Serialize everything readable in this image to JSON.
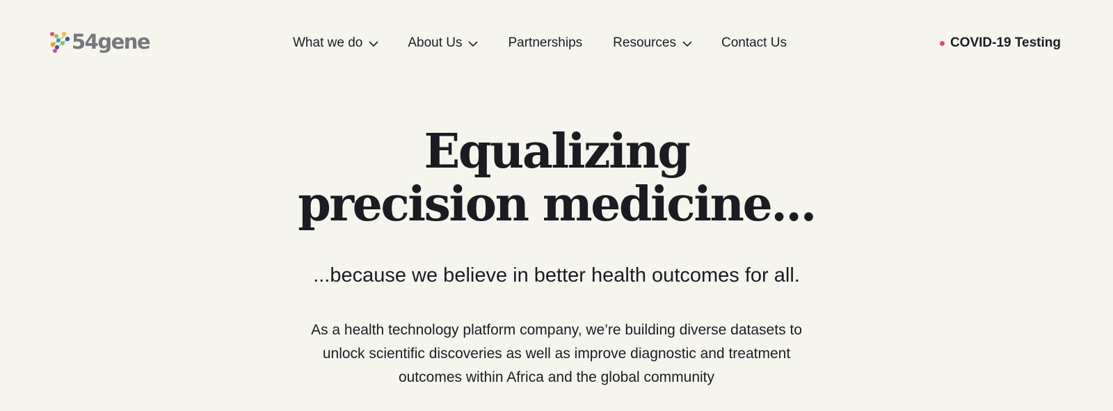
{
  "brand": {
    "name": "54gene",
    "logo_icon": "molecule-dots-logo-icon",
    "logo_colors": [
      "#f2c12e",
      "#8bc34a",
      "#26a69a",
      "#3f51b5",
      "#e8457a",
      "#f39c12"
    ]
  },
  "nav": {
    "items": [
      {
        "label": "What we do",
        "has_dropdown": true
      },
      {
        "label": "About Us",
        "has_dropdown": true
      },
      {
        "label": "Partnerships",
        "has_dropdown": false
      },
      {
        "label": "Resources",
        "has_dropdown": true
      },
      {
        "label": "Contact Us",
        "has_dropdown": false
      }
    ],
    "dropdown_icon": "chevron-down-icon"
  },
  "covid": {
    "label": "COVID-19 Testing",
    "dot_color": "#e8457a"
  },
  "hero": {
    "title_line1": "Equalizing",
    "title_line2": "precision medicine...",
    "subtitle": "...because we believe in better health outcomes for all.",
    "body_line1": "As a health technology platform company, we’re building diverse datasets to",
    "body_line2": "unlock scientific discoveries as well as improve diagnostic and treatment",
    "body_line3": "outcomes within Africa and the global community"
  },
  "colors": {
    "background": "#f5f5ee",
    "text": "#1b1c22",
    "logo_text": "#77787c",
    "accent": "#e8457a"
  }
}
